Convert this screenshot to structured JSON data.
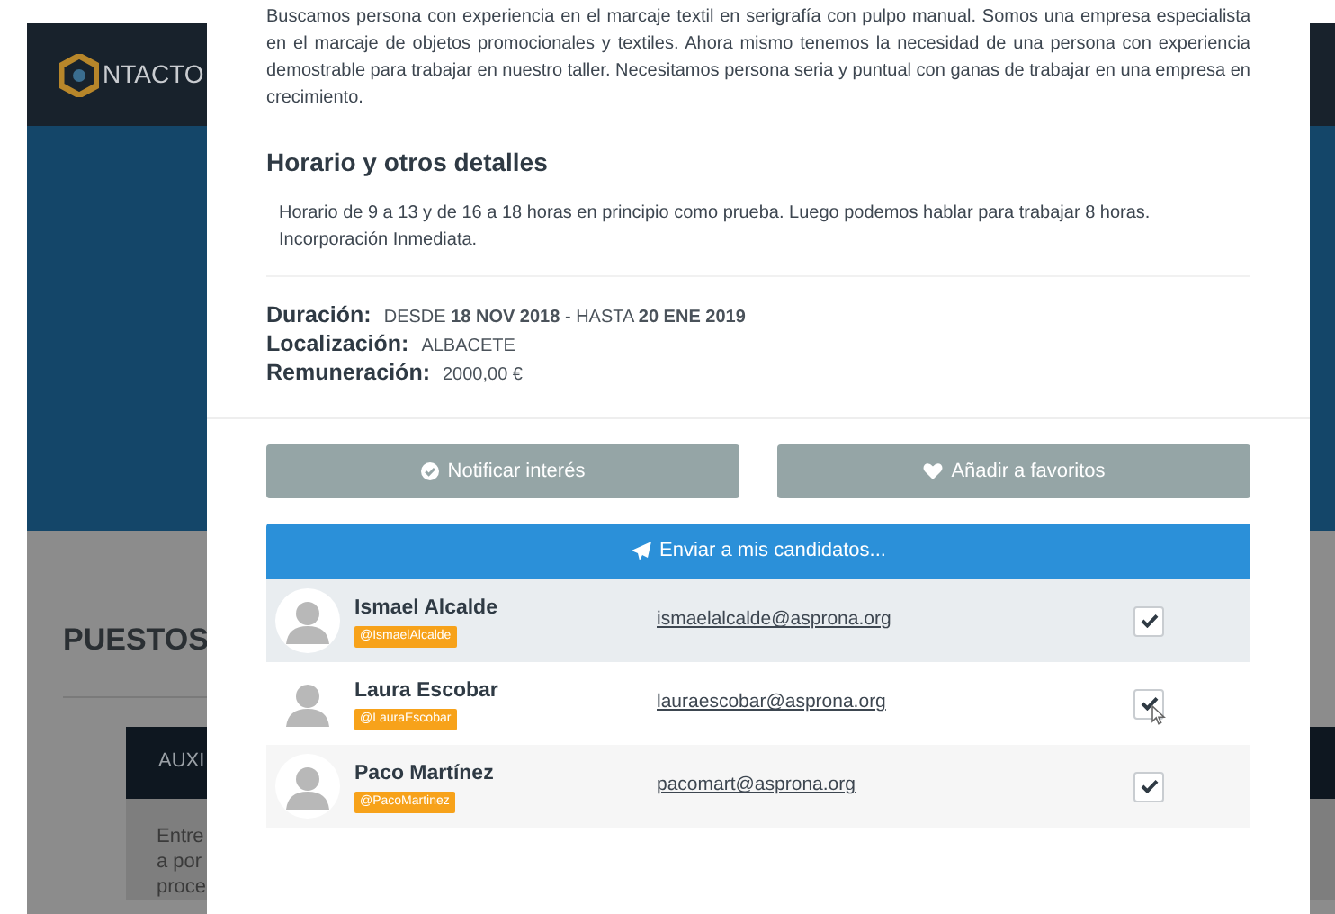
{
  "background": {
    "logo_text": "NTACTO",
    "section_title": "PUESTOS",
    "card_title": "AUXI",
    "card_lines": [
      "Entre",
      "a por",
      "proce"
    ]
  },
  "modal": {
    "description": "Buscamos persona con experiencia en el marcaje textil en serigrafía con pulpo manual. Somos una empresa especialista en el marcaje de objetos promocionales y textiles. Ahora mismo tenemos la necesidad de una persona con experiencia demostrable para trabajar en nuestro taller. Necesitamos persona seria y puntual con ganas de trabajar en una empresa en crecimiento.",
    "schedule_heading": "Horario y otros detalles",
    "schedule_text": "Horario de 9 a 13 y de 16 a 18 horas en principio como prueba. Luego podemos hablar para trabajar 8 horas. Incorporación Inmediata.",
    "details": [
      {
        "label": "Duración:",
        "value": "DESDE **18 NOV 2018** - HASTA **20 ENE 2019**"
      },
      {
        "label": "Localización:",
        "value": "ALBACETE"
      },
      {
        "label": "Remuneración:",
        "value": "2000,00 €"
      }
    ],
    "notify_button": "Notificar interés",
    "favorite_button": "Añadir a favoritos",
    "send_button": "Enviar a mis candidatos...",
    "candidates": [
      {
        "name": "Ismael Alcalde",
        "handle": "@IsmaelAlcalde",
        "email": "ismaelalcalde@asprona.org",
        "checked": true,
        "selected": true
      },
      {
        "name": "Laura Escobar",
        "handle": "@LauraEscobar",
        "email": "lauraescobar@asprona.org",
        "checked": true,
        "selected": false
      },
      {
        "name": "Paco Martínez",
        "handle": "@PacoMartinez",
        "email": "pacomart@asprona.org",
        "checked": true,
        "selected": false
      }
    ]
  }
}
